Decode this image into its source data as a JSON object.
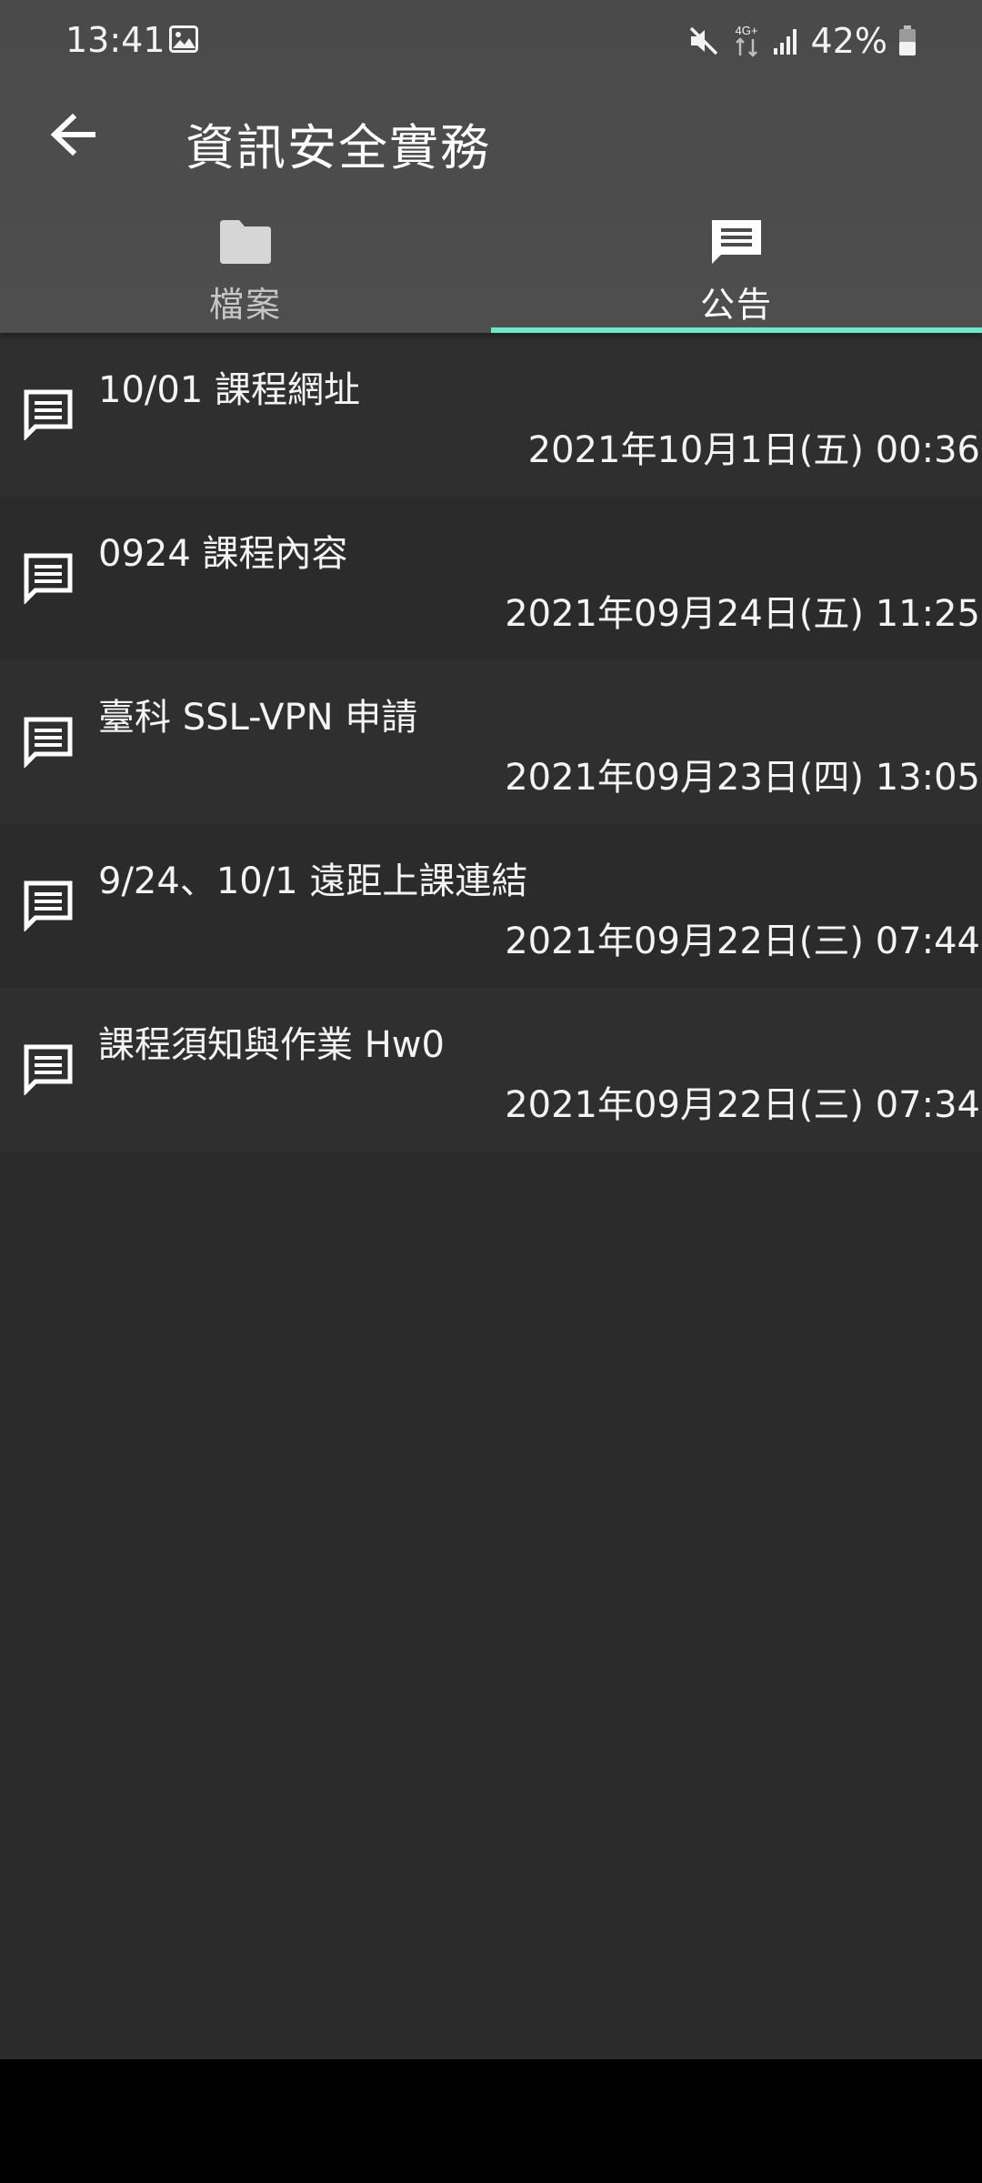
{
  "status_bar": {
    "time": "13:41",
    "network": "4G+",
    "battery": "42%",
    "icons": [
      "gallery-icon",
      "mute-icon",
      "network-4g-icon",
      "signal-icon",
      "battery-icon"
    ]
  },
  "toolbar": {
    "title": "資訊安全實務",
    "back_icon": "arrow-left-icon"
  },
  "tabs": [
    {
      "label": "檔案",
      "icon": "folder-icon",
      "active": false
    },
    {
      "label": "公告",
      "icon": "message-icon",
      "active": true
    }
  ],
  "announcements": [
    {
      "title": "10/01 課程網址",
      "date": "2021年10月1日(五) 00:36",
      "icon": "message-icon"
    },
    {
      "title": "0924 課程內容",
      "date": "2021年09月24日(五) 11:25",
      "icon": "message-icon"
    },
    {
      "title": "臺科 SSL-VPN 申請",
      "date": "2021年09月23日(四) 13:05",
      "icon": "message-icon"
    },
    {
      "title": "9/24、10/1 遠距上課連結",
      "date": "2021年09月22日(三) 07:44",
      "icon": "message-icon"
    },
    {
      "title": "課程須知與作業 Hw0",
      "date": "2021年09月22日(三) 07:34",
      "icon": "message-icon"
    }
  ],
  "colors": {
    "appbar": "#4c4c4c",
    "background": "#2b2b2b",
    "tab_indicator": "#6ee7c8",
    "navbar": "#000000"
  }
}
